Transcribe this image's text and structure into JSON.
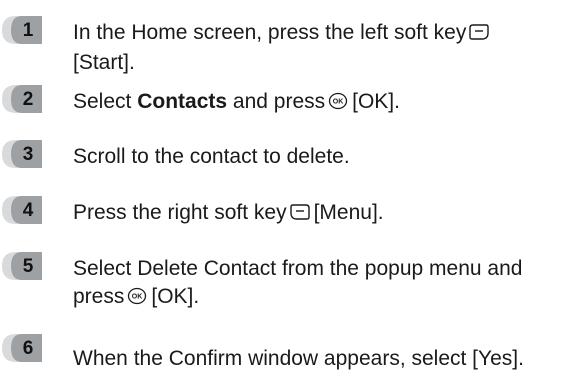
{
  "steps": [
    {
      "number": "1",
      "line1_before": "In the Home screen, press the left soft key",
      "icon": "left-soft-key-icon",
      "line2": "[Start]."
    },
    {
      "number": "2",
      "before": "Select ",
      "bold": "Contacts",
      "middle": " and press",
      "icon": "ok-key-icon",
      "after": "[OK]."
    },
    {
      "number": "3",
      "text": "Scroll to the contact to delete."
    },
    {
      "number": "4",
      "before": "Press the right soft key",
      "icon": "right-soft-key-icon",
      "after": "[Menu]."
    },
    {
      "number": "5",
      "line1": "Select Delete Contact from the popup menu and",
      "line2_before": "press",
      "icon": "ok-key-icon",
      "line2_after": "[OK]."
    },
    {
      "number": "6",
      "text": "When the Confirm window appears, select [Yes]."
    }
  ],
  "colors": {
    "badge_light": "#d9dadb",
    "badge_dark": "#9ea1a4",
    "text": "#1a1a1a"
  }
}
